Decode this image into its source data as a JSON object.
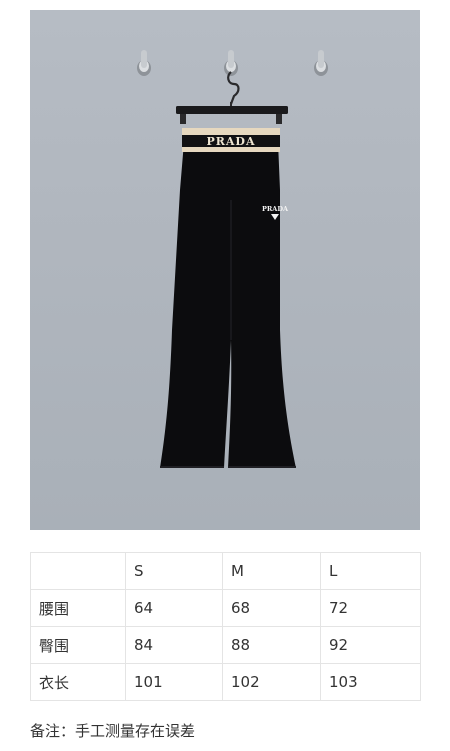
{
  "product_photo": {
    "waistband_text": "PRADA",
    "logo_text": "PRADA",
    "colors": {
      "wall": "#b0b6be",
      "garment": "#0c0c0e",
      "waistband_stripe": "#e6d8bf"
    }
  },
  "size_table": {
    "headers": [
      "",
      "S",
      "M",
      "L"
    ],
    "rows": [
      {
        "label": "腰围",
        "values": [
          "64",
          "68",
          "72"
        ]
      },
      {
        "label": "臀围",
        "values": [
          "84",
          "88",
          "92"
        ]
      },
      {
        "label": "衣长",
        "values": [
          "101",
          "102",
          "103"
        ]
      }
    ]
  },
  "note": "备注：手工测量存在误差"
}
